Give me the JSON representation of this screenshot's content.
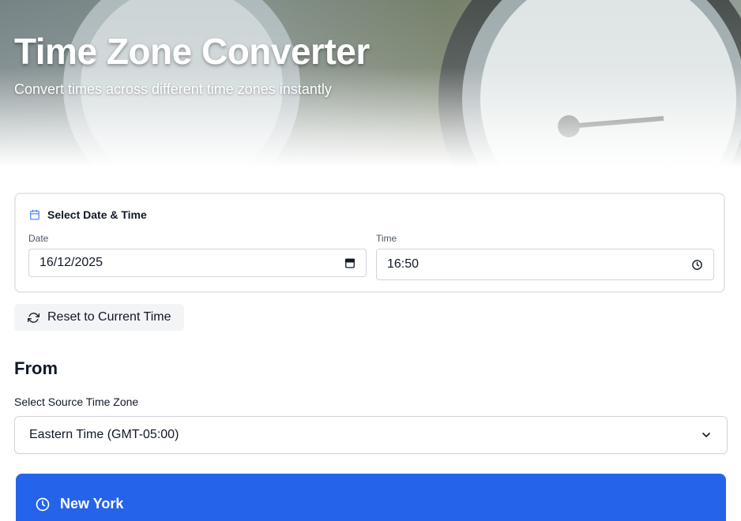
{
  "header": {
    "title": "Time Zone Converter",
    "subtitle": "Convert times across different time zones instantly"
  },
  "datetime_card": {
    "heading": "Select Date & Time",
    "date_label": "Date",
    "date_value": "16/12/2025",
    "time_label": "Time",
    "time_value": "16:50"
  },
  "reset_button": {
    "label": "Reset to Current Time"
  },
  "from_section": {
    "heading": "From",
    "select_label": "Select Source Time Zone",
    "selected_zone": "Eastern Time (GMT-05:00)"
  },
  "zone_card": {
    "city": "New York"
  },
  "colors": {
    "accent": "#2563eb",
    "icon_blue": "#3b82f6",
    "border": "#e5e7eb",
    "button_bg": "#f3f4f6"
  },
  "icons": [
    "calendar-icon",
    "calendar-picker-icon",
    "clock-icon",
    "refresh-icon",
    "chevron-down-icon",
    "clock-icon"
  ]
}
